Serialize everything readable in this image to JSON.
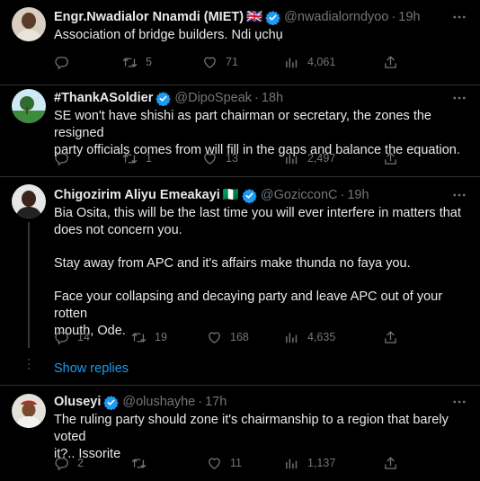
{
  "tweets": [
    {
      "name": "Engr.Nwadialor Nnamdi (MIET)",
      "flag": "🇬🇧",
      "handle": "@nwadialorndyoo",
      "time": "19h",
      "lines": [
        "Association of bridge builders. Ndi ụchụ"
      ],
      "replies": "",
      "retweets": "5",
      "likes": "71",
      "views": "4,061"
    },
    {
      "name": "#ThankASoldier",
      "flag": "",
      "handle": "@DipoSpeak",
      "time": "18h",
      "lines": [
        "SE won't have shishi as part chairman or secretary, the zones the resigned",
        "party officials comes from will fill in the gaps and balance the equation."
      ],
      "replies": "",
      "retweets": "1",
      "likes": "13",
      "views": "2,497"
    },
    {
      "name": "Chigozirim Aliyu Emeakayi",
      "flag": "🇳🇬",
      "handle": "@GozicconC",
      "time": "19h",
      "lines": [
        "Bia Osita, this will be the last time you will ever interfere in matters that",
        "does not concern you.",
        "Stay away from APC and it's affairs make thunda no faya you.",
        "Face your collapsing and decaying party and leave APC out of your rotten",
        "mouth, Ode."
      ],
      "replies": "14",
      "retweets": "19",
      "likes": "168",
      "views": "4,635",
      "show_replies": "Show replies"
    },
    {
      "name": "Oluseyi",
      "flag": "",
      "handle": "@olushayhe",
      "time": "17h",
      "lines": [
        "The ruling party should zone it's chairmanship to a region  that barely voted",
        "it?.. Issorite"
      ],
      "replies": "2",
      "retweets": "",
      "likes": "11",
      "views": "1,137"
    }
  ],
  "separator": "·",
  "colors": {
    "background": "#000000",
    "text": "#e7e9ea",
    "muted": "#71767b",
    "accent": "#1d9bf0",
    "divider": "#2f3336"
  },
  "icons": [
    "more-icon",
    "reply-icon",
    "retweet-icon",
    "like-icon",
    "views-icon",
    "share-icon",
    "verified-badge-icon"
  ]
}
